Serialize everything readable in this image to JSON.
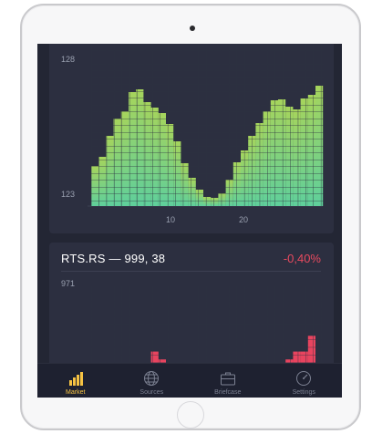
{
  "colors": {
    "screen_bg": "#232634",
    "card_bg": "#2c2f40",
    "green_top": "#a6d45c",
    "green_bottom": "#5fcf9b",
    "red": "#e8445f",
    "active_tab": "#f6c343",
    "inactive_tab": "#7c8192"
  },
  "chart_top": {
    "y_max_label": "128",
    "y_min_label": "123",
    "x_ticks": [
      "10",
      "20"
    ]
  },
  "card2": {
    "title": "RTS.RS — 999, 38",
    "change": "-0,40%",
    "y_max_label": "971"
  },
  "chart_data": [
    {
      "type": "bar",
      "x": [
        1,
        2,
        3,
        4,
        5,
        6,
        7,
        8,
        9,
        10,
        11,
        12,
        13,
        14,
        15,
        16,
        17,
        18,
        19,
        20,
        21,
        22,
        23,
        24,
        25,
        26,
        27,
        28,
        29,
        30,
        31
      ],
      "values": [
        4.4,
        5.4,
        7.7,
        9.6,
        10.4,
        12.5,
        12.8,
        11.4,
        10.8,
        10.2,
        9,
        7.1,
        4.7,
        3.1,
        1.8,
        1,
        0.9,
        1.4,
        2.9,
        4.8,
        6.1,
        7.7,
        9.1,
        10.4,
        11.6,
        11.7,
        10.9,
        10.6,
        11.8,
        12.2,
        13.2
      ],
      "xlabel": "",
      "ylabel": "",
      "ticks_y": [
        "123",
        "128"
      ],
      "ticks_x": [
        "10",
        "20"
      ]
    },
    {
      "type": "bar",
      "values": [
        0,
        0,
        0,
        0,
        3,
        5,
        4,
        1,
        7,
        6,
        2,
        4,
        3,
        2,
        1,
        0,
        0,
        0,
        0,
        0,
        1,
        3,
        0,
        4,
        5,
        5,
        6,
        7,
        7,
        9,
        0
      ],
      "ticks_y": [
        "971"
      ]
    }
  ],
  "tabs": [
    {
      "label": "Market",
      "icon": "bar-chart-icon",
      "active": true
    },
    {
      "label": "Sources",
      "icon": "globe-icon",
      "active": false
    },
    {
      "label": "Briefcase",
      "icon": "briefcase-icon",
      "active": false
    },
    {
      "label": "Settings",
      "icon": "speedometer-icon",
      "active": false
    }
  ]
}
